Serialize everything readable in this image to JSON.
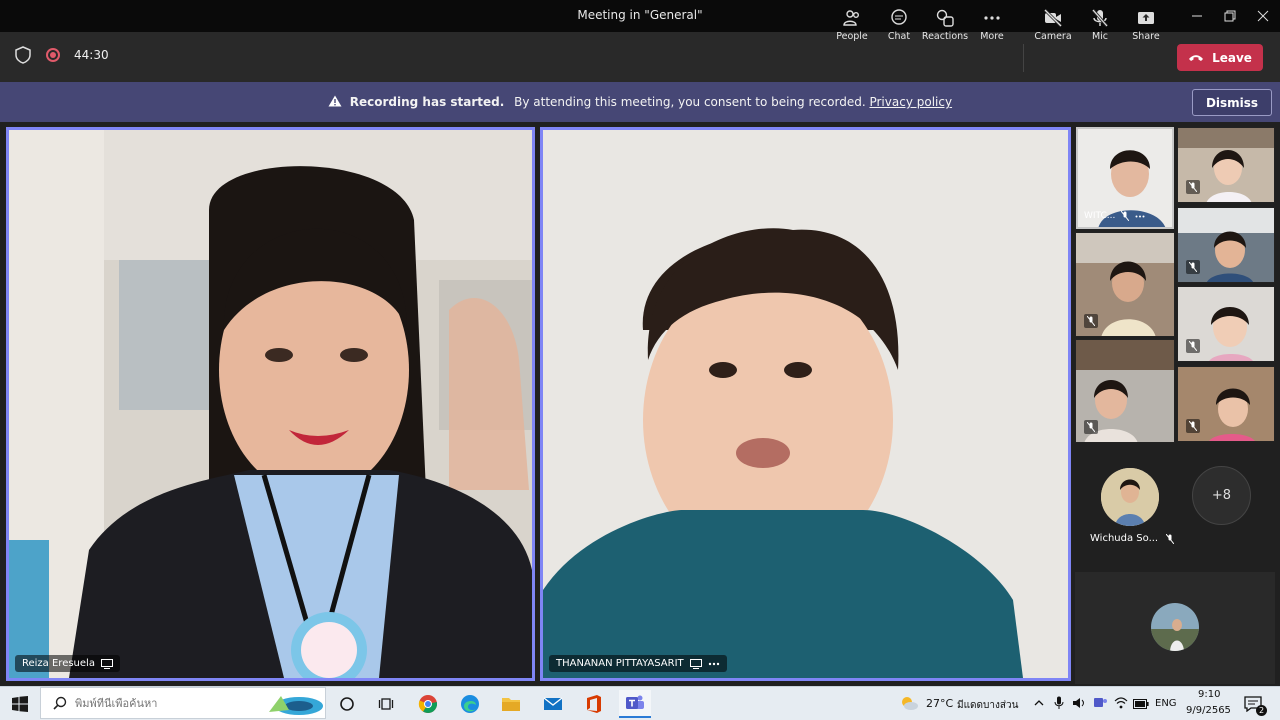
{
  "window": {
    "title": "Meeting in \"General\""
  },
  "toolbar": {
    "timer": "44:30",
    "people_label": "People",
    "chat_label": "Chat",
    "reactions_label": "Reactions",
    "more_label": "More",
    "camera_label": "Camera",
    "mic_label": "Mic",
    "share_label": "Share",
    "leave_label": "Leave",
    "leave_color": "#c4314b"
  },
  "banner": {
    "title": "Recording has started.",
    "message": "By attending this meeting, you consent to being recorded.",
    "link": "Privacy policy",
    "dismiss_label": "Dismiss",
    "background": "#464775"
  },
  "stage": {
    "highlight_color": "#7f85f5",
    "tiles": [
      {
        "name": "Reiza Eresuela"
      },
      {
        "name": "THANANAN PITTAYASARIT"
      }
    ],
    "thumbnails": [
      {
        "name": "WITC..."
      }
    ],
    "avatar_name": "Wichuda So...",
    "overflow_count": "+8"
  },
  "taskbar": {
    "search_placeholder": "พิมพ์ที่นี่เพื่อค้นหา",
    "weather_temp": "27°C",
    "weather_text": "มีแดดบางส่วน",
    "language": "ENG",
    "time": "9:10",
    "date": "9/9/2565",
    "notification_count": "2"
  },
  "icons": [
    "shield-icon",
    "record-icon",
    "people-icon",
    "chat-icon",
    "reactions-icon",
    "more-icon",
    "camera-off-icon",
    "mic-off-icon",
    "share-icon",
    "phone-icon",
    "warning-icon"
  ]
}
